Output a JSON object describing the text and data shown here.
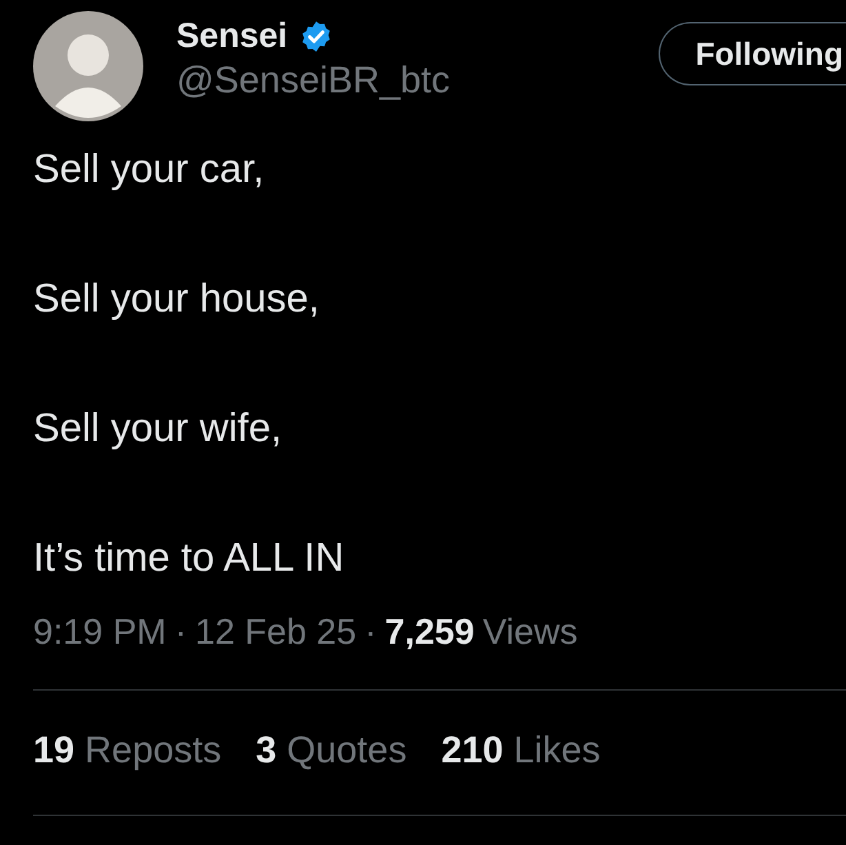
{
  "author": {
    "name": "Sensei",
    "verified": true,
    "handle": "@SenseiBR_btc"
  },
  "follow_button": {
    "label": "Following"
  },
  "text_lines": [
    "Sell your car,",
    "Sell your house,",
    "Sell your wife,",
    "It’s time to ALL IN"
  ],
  "meta": {
    "time": "9:19 PM",
    "separator_1": "·",
    "date": "12 Feb 25",
    "separator_2": "·",
    "views_count": "7,259",
    "views_label": "Views"
  },
  "stats": [
    {
      "count": "19",
      "label": "Reposts"
    },
    {
      "count": "3",
      "label": "Quotes"
    },
    {
      "count": "210",
      "label": "Likes"
    }
  ]
}
